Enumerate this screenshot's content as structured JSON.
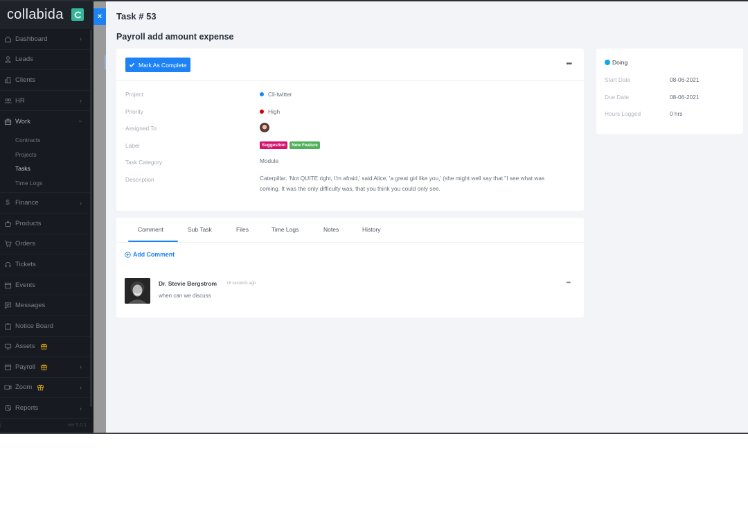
{
  "sidebar": {
    "brand": "collabida",
    "version": "ver 5.0.1",
    "items": [
      {
        "label": "Dashboard",
        "icon": "home-icon",
        "has_chevron": true
      },
      {
        "label": "Leads",
        "icon": "user-icon",
        "has_chevron": false
      },
      {
        "label": "Clients",
        "icon": "building-icon",
        "has_chevron": false
      },
      {
        "label": "HR",
        "icon": "people-icon",
        "has_chevron": true
      },
      {
        "label": "Work",
        "icon": "briefcase-icon",
        "has_chevron": true,
        "expanded": true
      },
      {
        "label": "Finance",
        "icon": "dollar-icon",
        "has_chevron": true
      },
      {
        "label": "Products",
        "icon": "basket-icon",
        "has_chevron": false
      },
      {
        "label": "Orders",
        "icon": "cart-icon",
        "has_chevron": false
      },
      {
        "label": "Tickets",
        "icon": "headset-icon",
        "has_chevron": false
      },
      {
        "label": "Events",
        "icon": "calendar-icon",
        "has_chevron": false
      },
      {
        "label": "Messages",
        "icon": "chat-icon",
        "has_chevron": false
      },
      {
        "label": "Notice Board",
        "icon": "clipboard-icon",
        "has_chevron": false
      },
      {
        "label": "Assets",
        "icon": "monitor-icon",
        "has_chevron": false,
        "gift": true
      },
      {
        "label": "Payroll",
        "icon": "wallet-icon",
        "has_chevron": true,
        "gift": true
      },
      {
        "label": "Zoom",
        "icon": "video-icon",
        "has_chevron": true,
        "gift": true
      },
      {
        "label": "Reports",
        "icon": "pie-chart-icon",
        "has_chevron": true
      }
    ],
    "work_submenu": [
      {
        "label": "Contracts",
        "active": false
      },
      {
        "label": "Projects",
        "active": false
      },
      {
        "label": "Tasks",
        "active": true
      },
      {
        "label": "Time Logs",
        "active": false
      }
    ],
    "close_label": "×",
    "collapse_label": "‹"
  },
  "header": {
    "task_number": "Task # 53",
    "task_title": "Payroll add amount expense"
  },
  "details": {
    "mark_complete_label": "Mark As Complete",
    "more_label": "•••",
    "rows": {
      "project": {
        "label": "Project",
        "value": "Cli-twitter",
        "dot_color": "#1d82f5"
      },
      "priority": {
        "label": "Priority",
        "value": "High",
        "dot_color": "#d30000"
      },
      "assigned": {
        "label": "Assigned To"
      },
      "label": {
        "label": "Label",
        "tags": [
          {
            "text": "Suggestion",
            "color": "#d5116b"
          },
          {
            "text": "New Feature",
            "color": "#4fb15b"
          }
        ]
      },
      "category": {
        "label": "Task Category",
        "value": "Module"
      },
      "description": {
        "label": "Description",
        "value": "Caterpillar. 'Not QUITE right, I'm afraid,' said Alice, 'a great girl like you,' (she might well say that \"I see what was coming. It was the only difficulty was, that you think you could only see."
      }
    }
  },
  "tabs": {
    "items": [
      "Comment",
      "Sub Task",
      "Files",
      "Time Logs",
      "Notes",
      "History"
    ],
    "active": "Comment",
    "add_comment_label": "Add Comment",
    "comment": {
      "author": "Dr. Stevie Bergstrom",
      "time": "16 seconds ago",
      "text": "when can we discuss",
      "more_label": "•••"
    }
  },
  "status": {
    "label": "Doing",
    "color": "#11a6f0",
    "rows": [
      {
        "label": "Start Date",
        "value": "08-06-2021"
      },
      {
        "label": "Due Date",
        "value": "08-06-2021"
      },
      {
        "label": "Hours Logged",
        "value": "0 hrs"
      }
    ]
  },
  "colors": {
    "accent": "#1d82f5",
    "sidebar_bg": "#171a20",
    "page_bg": "#f2f4f7"
  }
}
